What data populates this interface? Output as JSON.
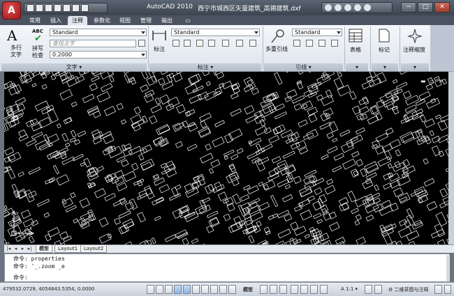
{
  "title": {
    "app": "AutoCAD 2010",
    "file": "西宁市城西区矢量建筑_高德建筑.dxf"
  },
  "ribbon_tabs": [
    "常用",
    "插入",
    "注释",
    "参数化",
    "视图",
    "管理",
    "输出"
  ],
  "active_tab": "注释",
  "text_panel": {
    "multiline_text_label": "多行\n文字",
    "abc_label": "ABC",
    "spell_check_label": "拼写\n检查",
    "text_style": "Standard",
    "find_text_placeholder": "查找文字",
    "text_height": "0.2000",
    "footer": "文字"
  },
  "dimension_panel": {
    "dimension_label": "标注",
    "dim_style": "Standard",
    "footer": "标注"
  },
  "leader_panel": {
    "multileader_label": "多重引线",
    "leader_style": "Standard",
    "footer": "引线"
  },
  "table_panel": {
    "label": "表格"
  },
  "mark_panel": {
    "label": "标记"
  },
  "scale_panel": {
    "label": "注释缩放"
  },
  "layout_tabs": [
    "模型",
    "Layout1",
    "Layout2"
  ],
  "active_layout": "模型",
  "command_history": [
    "命令: properties",
    "命令: '_.zoom _e",
    "命令:"
  ],
  "status": {
    "coordinates": "479532.0729, 4054843.5354, 0.0000",
    "model_label": "模型",
    "annotation_scale": "1:1",
    "workspace": "二维草图与注释"
  },
  "colors": {
    "canvas": "#000000",
    "linework": "#ffffff",
    "titlebar": "#4b5360",
    "ribbon": "#e6ecf2"
  }
}
